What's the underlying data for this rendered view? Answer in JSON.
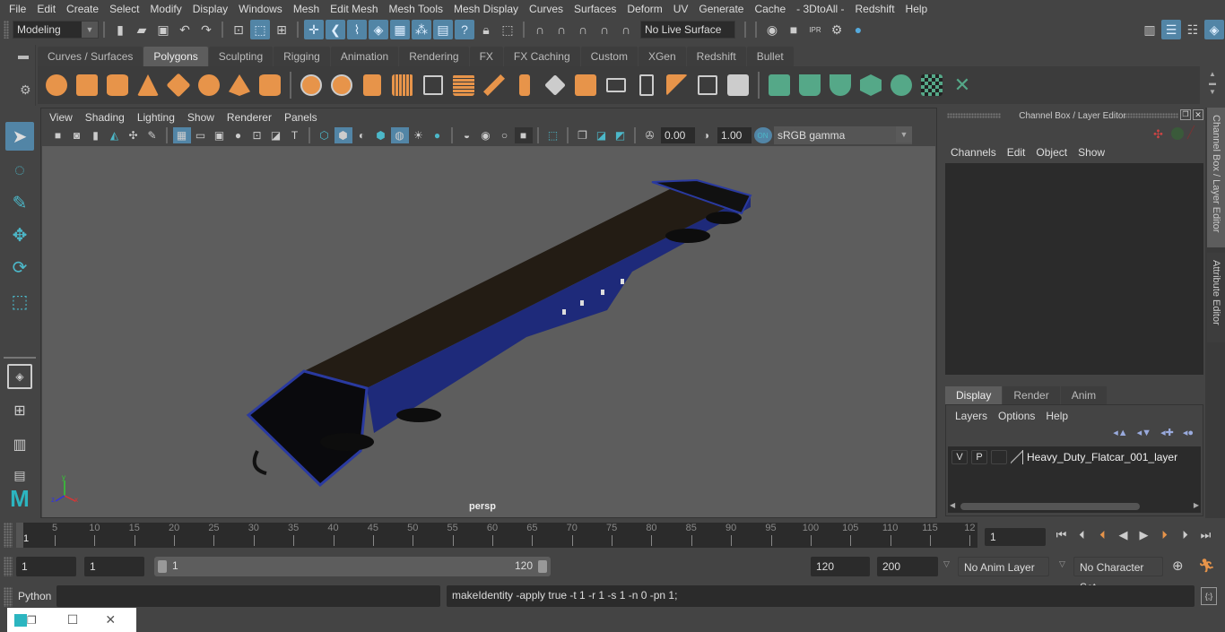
{
  "menubar": {
    "items": [
      "File",
      "Edit",
      "Create",
      "Select",
      "Modify",
      "Display",
      "Windows",
      "Mesh",
      "Edit Mesh",
      "Mesh Tools",
      "Mesh Display",
      "Curves",
      "Surfaces",
      "Deform",
      "UV",
      "Generate",
      "Cache",
      "- 3DtoAll -",
      "Redshift",
      "Help"
    ]
  },
  "statusline": {
    "mode": "Modeling",
    "live_surface": "No Live Surface"
  },
  "shelf": {
    "tabs": [
      "Curves / Surfaces",
      "Polygons",
      "Sculpting",
      "Rigging",
      "Animation",
      "Rendering",
      "FX",
      "FX Caching",
      "Custom",
      "XGen",
      "Redshift",
      "Bullet"
    ],
    "active_tab": "Polygons"
  },
  "viewport": {
    "menu": [
      "View",
      "Shading",
      "Lighting",
      "Show",
      "Renderer",
      "Panels"
    ],
    "exposure": "0.00",
    "gamma": "1.00",
    "color_space": "sRGB gamma",
    "camera_label": "persp",
    "axis": {
      "x": "x",
      "y": "y",
      "z": "z"
    }
  },
  "channel_box": {
    "title": "Channel Box / Layer Editor",
    "menu": [
      "Channels",
      "Edit",
      "Object",
      "Show"
    ]
  },
  "layer_editor": {
    "tabs": [
      "Display",
      "Render",
      "Anim"
    ],
    "active_tab": "Display",
    "menu": [
      "Layers",
      "Options",
      "Help"
    ],
    "layers": [
      {
        "visible": "V",
        "playback": "P",
        "name": "Heavy_Duty_Flatcar_001_layer"
      }
    ]
  },
  "side_tabs": [
    "Channel Box / Layer Editor",
    "Attribute Editor"
  ],
  "timeslider": {
    "ticks": [
      "5",
      "10",
      "15",
      "20",
      "25",
      "30",
      "35",
      "40",
      "45",
      "50",
      "55",
      "60",
      "65",
      "70",
      "75",
      "80",
      "85",
      "90",
      "95",
      "100",
      "105",
      "110",
      "115",
      "12"
    ],
    "current_marker": "1",
    "current_frame": "1"
  },
  "range": {
    "start": "1",
    "playback_start": "1",
    "slider_start": "1",
    "slider_end": "120",
    "playback_end": "120",
    "end": "200",
    "anim_layer": "No Anim Layer",
    "character_set": "No Character Set"
  },
  "command_line": {
    "language": "Python",
    "input": "",
    "result": "makeIdentity -apply true -t 1 -r 1 -s 1 -n 0 -pn 1;"
  }
}
